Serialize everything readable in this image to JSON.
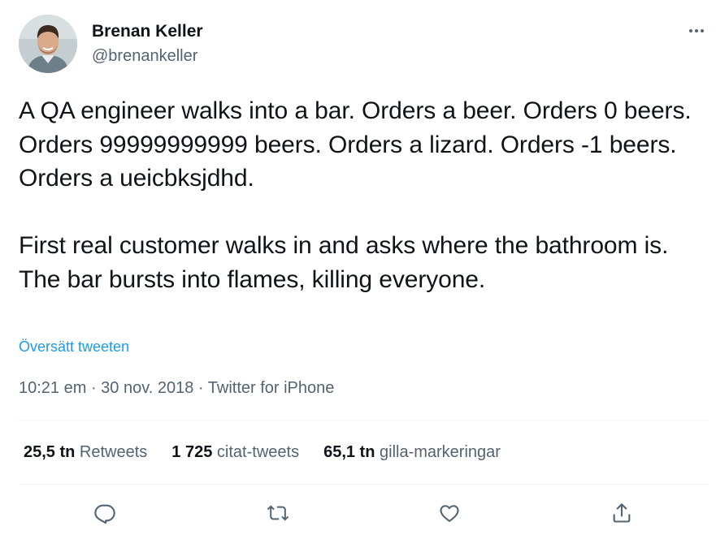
{
  "author": {
    "display_name": "Brenan Keller",
    "handle": "@brenankeller",
    "avatar_icon": "profile-photo"
  },
  "menu": {
    "more_icon": "more-horizontal-icon"
  },
  "tweet": {
    "text": "A QA engineer walks into a bar. Orders a beer. Orders 0 beers. Orders 99999999999 beers. Orders a lizard. Orders -1 beers. Orders a ueicbksjdhd.\n\nFirst real customer walks in and asks where the bathroom is. The bar bursts into flames, killing everyone.",
    "translate_label": "Översätt tweeten"
  },
  "meta": {
    "time": "10:21 em",
    "separator": " · ",
    "date": "30 nov. 2018",
    "source": "Twitter for iPhone"
  },
  "stats": {
    "retweets": {
      "count": "25,5 tn",
      "label": "Retweets"
    },
    "quotes": {
      "count": "1 725",
      "label": "citat-tweets"
    },
    "likes": {
      "count": "65,1 tn",
      "label": "gilla-markeringar"
    }
  },
  "actions": {
    "reply_icon": "reply-icon",
    "retweet_icon": "retweet-icon",
    "like_icon": "heart-icon",
    "share_icon": "share-icon"
  },
  "colors": {
    "text_primary": "#0f1419",
    "text_secondary": "#536471",
    "link": "#1d9bf0",
    "divider": "#eff3f4"
  }
}
